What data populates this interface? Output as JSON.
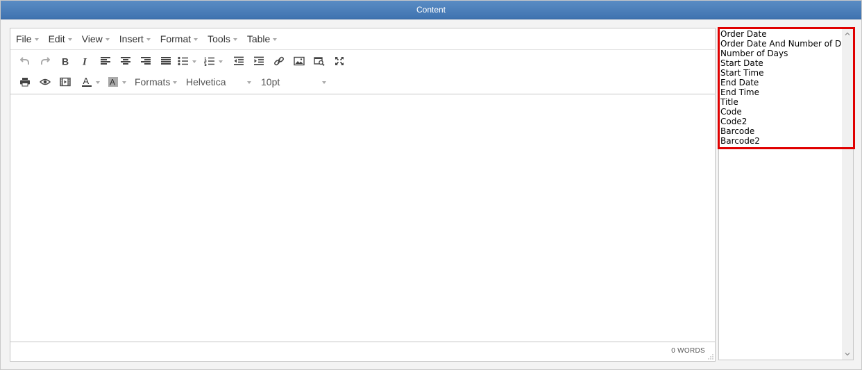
{
  "header": {
    "title": "Content"
  },
  "menubar": {
    "items": [
      {
        "label": "File"
      },
      {
        "label": "Edit"
      },
      {
        "label": "View"
      },
      {
        "label": "Insert"
      },
      {
        "label": "Format"
      },
      {
        "label": "Tools"
      },
      {
        "label": "Table"
      }
    ]
  },
  "toolbar": {
    "row1_icons": [
      "undo-icon",
      "redo-icon",
      "bold-icon",
      "italic-icon",
      "align-left-icon",
      "align-center-icon",
      "align-right-icon",
      "align-justify-icon",
      "bullet-list-icon",
      "numbered-list-icon",
      "outdent-icon",
      "indent-icon",
      "link-icon",
      "image-icon",
      "media-search-icon",
      "fullscreen-icon"
    ],
    "row2_icons": [
      "print-icon",
      "preview-icon",
      "media-icon",
      "text-color-icon",
      "background-color-icon"
    ],
    "formats_label": "Formats",
    "font_family": "Helvetica",
    "font_size": "10pt"
  },
  "statusbar": {
    "word_count": "0 WORDS"
  },
  "fields": {
    "items": [
      "Order Date",
      "Order Date And Number of Days",
      "Number of Days",
      "Start Date",
      "Start Time",
      "End Date",
      "End Time",
      "Title",
      "Code",
      "Code2",
      "Barcode",
      "Barcode2"
    ]
  },
  "colors": {
    "header_bg": "#4a7fbd",
    "highlight_border": "#e00000"
  }
}
